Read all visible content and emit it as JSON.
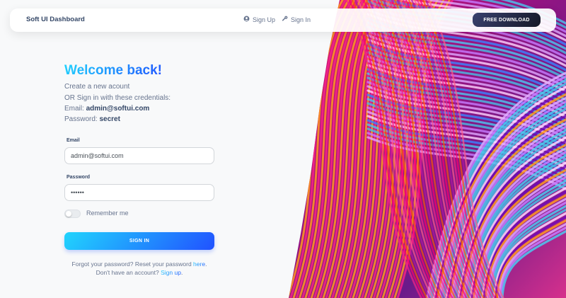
{
  "navbar": {
    "brand": "Soft UI Dashboard",
    "signup_label": "Sign Up",
    "signin_label": "Sign In",
    "download_label": "FREE DOWNLOAD"
  },
  "login": {
    "heading": "Welcome back!",
    "desc_line1": "Create a new acount",
    "desc_line2": "OR Sign in with these credentials:",
    "email_prefix": "Email: ",
    "email_value": "admin@softui.com",
    "password_prefix": "Password: ",
    "password_value": "secret",
    "email_label": "Email",
    "email_input": "admin@softui.com",
    "password_label": "Password",
    "password_input": "secret",
    "remember_label": "Remember me",
    "remember_checked": false,
    "submit_label": "SIGN IN",
    "forgot_text": "Forgot your password? Reset your password ",
    "forgot_link": "here",
    "forgot_suffix": ".",
    "noaccount_text": "Don't have an account? ",
    "signup_link": "Sign up",
    "signup_suffix": "."
  },
  "colors": {
    "primary_gradient_start": "#21d4fd",
    "primary_gradient_end": "#2152ff",
    "dark_button": "#3a416f",
    "text_heading": "#344767",
    "text_body": "#67748e"
  },
  "icons": {
    "signup": "user-circle-icon",
    "signin": "key-icon"
  }
}
